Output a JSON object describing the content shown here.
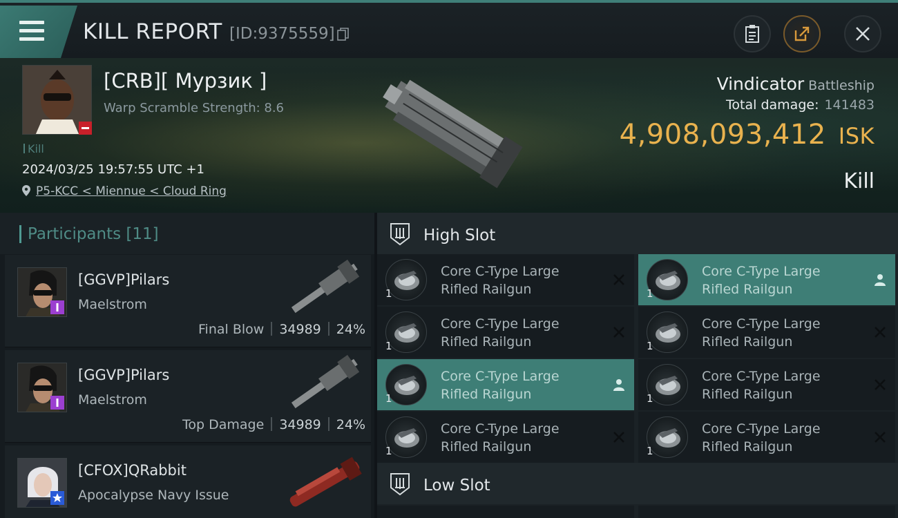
{
  "header": {
    "title": "KILL REPORT",
    "report_id": "[ID:9375559]",
    "icons": [
      "menu-icon",
      "copy-icon",
      "clipboard-icon",
      "share-icon",
      "close-icon"
    ]
  },
  "victim": {
    "name": "[CRB][ Мурзик ]",
    "warp_scramble": "Warp Scramble Strength: 8.6",
    "kills_label": "Kill",
    "datetime": "2024/03/25 19:57:55 UTC +1",
    "location": "P5-KCC < Miennue < Cloud Ring"
  },
  "ship": {
    "name": "Vindicator",
    "class": "Battleship",
    "total_damage_label": "Total damage:",
    "total_damage": "141483",
    "isk_value": "4,908,093,412",
    "isk_unit": "ISK",
    "result": "Kill"
  },
  "participants": {
    "title": "Participants",
    "count": "[11]",
    "items": [
      {
        "name": "[GGVP]Pilars",
        "ship": "Maelstrom",
        "role": "Final Blow",
        "damage": "34989",
        "percent": "24%",
        "badge_color": "#9b3fd0"
      },
      {
        "name": "[GGVP]Pilars",
        "ship": "Maelstrom",
        "role": "Top Damage",
        "damage": "34989",
        "percent": "24%",
        "badge_color": "#9b3fd0"
      },
      {
        "name": "[CFOX]QRabbit",
        "ship": "Apocalypse Navy Issue",
        "badge_color": "#2a5bd7"
      }
    ]
  },
  "high_slot": {
    "title": "High Slot",
    "modules": [
      {
        "line1": "Core C-Type Large",
        "line2": "Rifled Railgun",
        "qty": "1",
        "status": "destroyed"
      },
      {
        "line1": "Core C-Type Large",
        "line2": "Rifled Railgun",
        "qty": "1",
        "status": "dropped"
      },
      {
        "line1": "Core C-Type Large",
        "line2": "Rifled Railgun",
        "qty": "1",
        "status": "destroyed"
      },
      {
        "line1": "Core C-Type Large",
        "line2": "Rifled Railgun",
        "qty": "1",
        "status": "destroyed"
      },
      {
        "line1": "Core C-Type Large",
        "line2": "Rifled Railgun",
        "qty": "1",
        "status": "dropped"
      },
      {
        "line1": "Core C-Type Large",
        "line2": "Rifled Railgun",
        "qty": "1",
        "status": "destroyed"
      },
      {
        "line1": "Core C-Type Large",
        "line2": "Rifled Railgun",
        "qty": "1",
        "status": "destroyed"
      },
      {
        "line1": "Core C-Type Large",
        "line2": "Rifled Railgun",
        "qty": "1",
        "status": "destroyed"
      }
    ]
  },
  "low_slot": {
    "title": "Low Slot"
  },
  "colors": {
    "accent": "#3e7e76",
    "isk": "#e9b24e",
    "kill_badge": "#c8202a"
  }
}
